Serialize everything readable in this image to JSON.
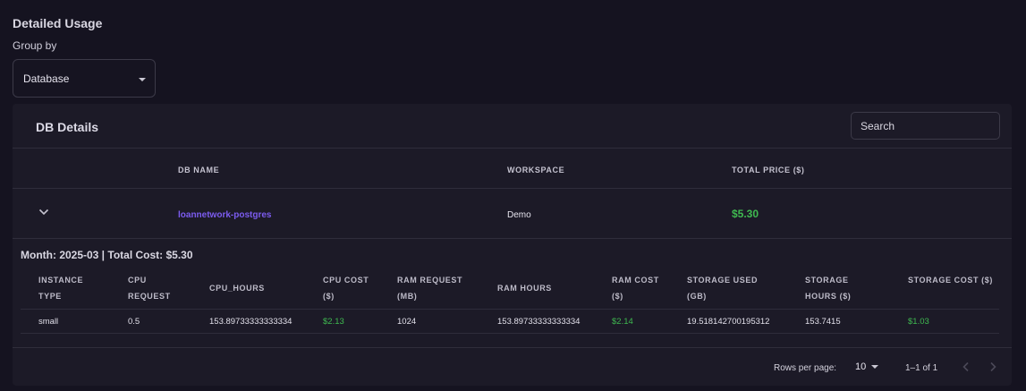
{
  "section": {
    "title": "Detailed Usage",
    "group_by_label": "Group by",
    "group_by_value": "Database"
  },
  "card": {
    "title": "DB Details",
    "search_placeholder": "Search",
    "columns": [
      "DB NAME",
      "WORKSPACE",
      "TOTAL PRICE ($)"
    ],
    "row": {
      "db_name": "loannetwork-postgres",
      "workspace": "Demo",
      "total_price": "$5.30"
    }
  },
  "details": {
    "month_title": "Month: 2025-03 | Total Cost: $5.30",
    "headers": [
      "INSTANCE TYPE",
      "CPU REQUEST",
      "CPU_HOURS",
      "CPU COST ($)",
      "RAM REQUEST (MB)",
      "RAM HOURS",
      "RAM COST ($)",
      "STORAGE USED (GB)",
      "STORAGE HOURS ($)",
      "STORAGE COST ($)"
    ],
    "row": [
      "small",
      "0.5",
      "153.89733333333334",
      "$2.13",
      "1024",
      "153.89733333333334",
      "$2.14",
      "19.518142700195312",
      "153.7415",
      "$1.03"
    ]
  },
  "pagination": {
    "rows_per_page_label": "Rows per page:",
    "rows_per_page_value": "10",
    "range_text": "1–1 of 1"
  },
  "colors": {
    "background": "#151320",
    "card": "#1c1a27",
    "link": "#7c5cf0",
    "cost": "#3fb950"
  },
  "icons": [
    "chevron-down-icon",
    "caret-down-icon",
    "chevron-left-icon",
    "chevron-right-icon"
  ]
}
